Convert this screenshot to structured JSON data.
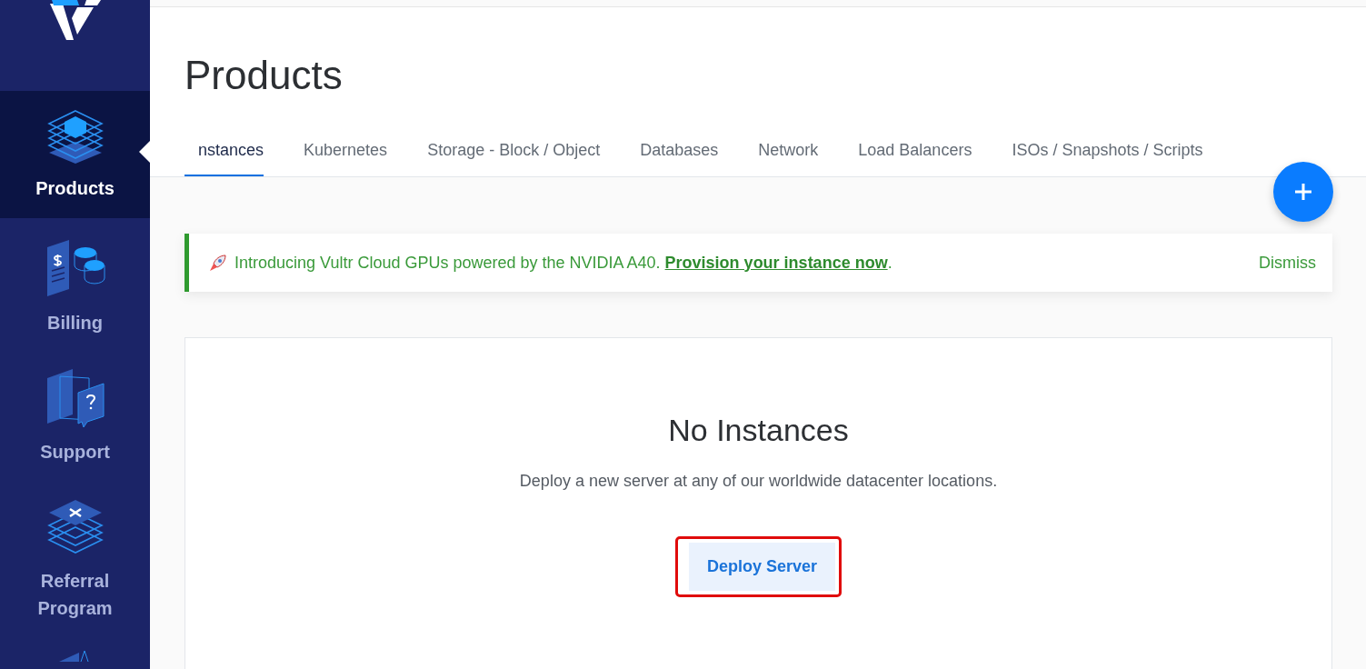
{
  "sidebar": {
    "items": [
      {
        "kind": "products",
        "label": "Products",
        "selected": true
      },
      {
        "kind": "billing",
        "label": "Billing",
        "selected": false
      },
      {
        "kind": "support",
        "label": "Support",
        "selected": false
      },
      {
        "kind": "referral",
        "label": "Referral Program",
        "selected": false
      }
    ]
  },
  "page": {
    "title": "Products"
  },
  "tabs": [
    {
      "label": "nstances",
      "selected": true
    },
    {
      "label": "Kubernetes",
      "selected": false
    },
    {
      "label": "Storage - Block / Object",
      "selected": false
    },
    {
      "label": "Databases",
      "selected": false
    },
    {
      "label": "Network",
      "selected": false
    },
    {
      "label": "Load Balancers",
      "selected": false
    },
    {
      "label": "ISOs / Snapshots / Scripts",
      "selected": false
    }
  ],
  "banner": {
    "text": "Introducing Vultr Cloud GPUs powered by the NVIDIA A40. ",
    "link": "Provision your instance now",
    "suffix": ".",
    "dismiss": "Dismiss"
  },
  "empty_state": {
    "title": "No Instances",
    "description": "Deploy a new server at any of our worldwide datacenter locations.",
    "button": "Deploy Server",
    "highlighted": true
  }
}
